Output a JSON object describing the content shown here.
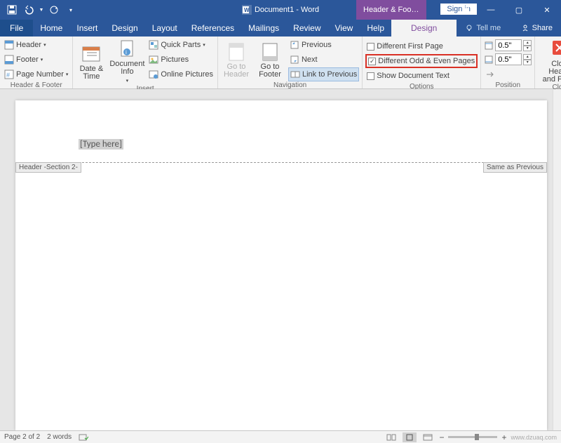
{
  "titlebar": {
    "doc_title": "Document1 - Word",
    "context_tab": "Header & Footer T...",
    "sign_in": "Sign in"
  },
  "tabs": {
    "file": "File",
    "home": "Home",
    "insert": "Insert",
    "design": "Design",
    "layout": "Layout",
    "references": "References",
    "mailings": "Mailings",
    "review": "Review",
    "view": "View",
    "help": "Help",
    "ctx_design": "Design",
    "tellme": "Tell me",
    "share": "Share"
  },
  "ribbon": {
    "hf": {
      "header": "Header",
      "footer": "Footer",
      "page_number": "Page Number",
      "group": "Header & Footer"
    },
    "insert": {
      "date_time": "Date &\nTime",
      "doc_info": "Document\nInfo",
      "quick_parts": "Quick Parts",
      "pictures": "Pictures",
      "online_pictures": "Online Pictures",
      "group": "Insert"
    },
    "nav": {
      "goto_header": "Go to\nHeader",
      "goto_footer": "Go to\nFooter",
      "previous": "Previous",
      "next": "Next",
      "link_prev": "Link to Previous",
      "group": "Navigation"
    },
    "options": {
      "diff_first": "Different First Page",
      "diff_oddeven": "Different Odd & Even Pages",
      "show_doc": "Show Document Text",
      "group": "Options"
    },
    "position": {
      "top_val": "0.5\"",
      "bottom_val": "0.5\"",
      "group": "Position"
    },
    "close": {
      "label": "Close Header\nand Footer",
      "group": "Close"
    }
  },
  "document": {
    "placeholder": "[Type here]",
    "header_tag": "Header -Section 2-",
    "same_prev": "Same as Previous"
  },
  "status": {
    "page": "Page 2 of 2",
    "words": "2 words",
    "lang_icon": "",
    "zoom": "",
    "watermark": "www.dzuaq.com"
  }
}
